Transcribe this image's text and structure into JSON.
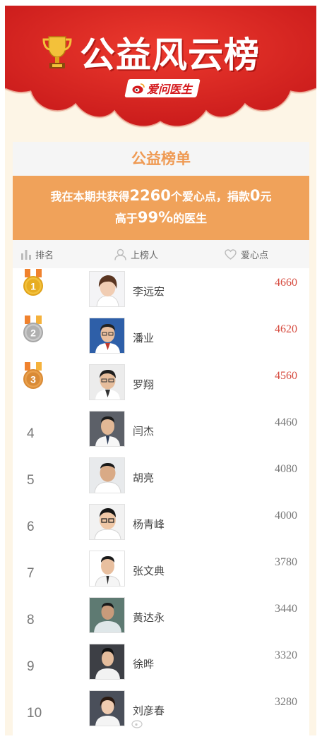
{
  "banner": {
    "title": "公益风云榜",
    "logo_text": "爱问医生"
  },
  "panel": {
    "title": "公益榜单",
    "stat": {
      "prefix": "我在本期共获得",
      "points": "2260",
      "middle": "个爱心点，捐款",
      "donation": "0",
      "suffix": "元",
      "line2_prefix": "高于",
      "percent": "99%",
      "line2_suffix": "的医生"
    }
  },
  "header": {
    "rank": "排名",
    "uploader": "上榜人",
    "points": "爱心点"
  },
  "rows": [
    {
      "rank": "1",
      "name": "李远宏",
      "points": "4660"
    },
    {
      "rank": "2",
      "name": "潘业",
      "points": "4620"
    },
    {
      "rank": "3",
      "name": "罗翔",
      "points": "4560"
    },
    {
      "rank": "4",
      "name": "闫杰",
      "points": "4460"
    },
    {
      "rank": "5",
      "name": "胡亮",
      "points": "4080"
    },
    {
      "rank": "6",
      "name": "杨青峰",
      "points": "4000"
    },
    {
      "rank": "7",
      "name": "张文典",
      "points": "3780"
    },
    {
      "rank": "8",
      "name": "黄达永",
      "points": "3440"
    },
    {
      "rank": "9",
      "name": "徐晔",
      "points": "3320"
    },
    {
      "rank": "10",
      "name": "刘彦春",
      "points": "3280"
    }
  ],
  "colors": {
    "banner_red": "#d92320",
    "accent_orange": "#f0a25a",
    "top_points": "#d64a3e",
    "gold": "#e0a21a",
    "silver": "#a6a6a6",
    "bronze": "#d98a35"
  },
  "icons": {
    "trophy": "trophy-icon",
    "rank": "bar-chart-icon",
    "uploader": "person-icon",
    "points": "heart-icon",
    "logo": "weibo-eye-icon"
  }
}
